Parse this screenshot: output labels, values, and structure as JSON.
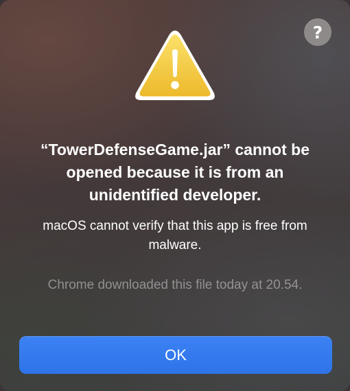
{
  "dialog": {
    "help_glyph": "?",
    "icon": "warning-triangle-icon",
    "title": "“TowerDefenseGame.jar” cannot be opened because it is from an unidentified developer.",
    "message": "macOS cannot verify that this app is free from malware.",
    "download_note": "Chrome downloaded this file today at 20.54.",
    "ok_label": "OK"
  },
  "colors": {
    "accent": "#3480f0",
    "warning_yellow": "#f5c842",
    "help_button": "#8e8a89"
  }
}
